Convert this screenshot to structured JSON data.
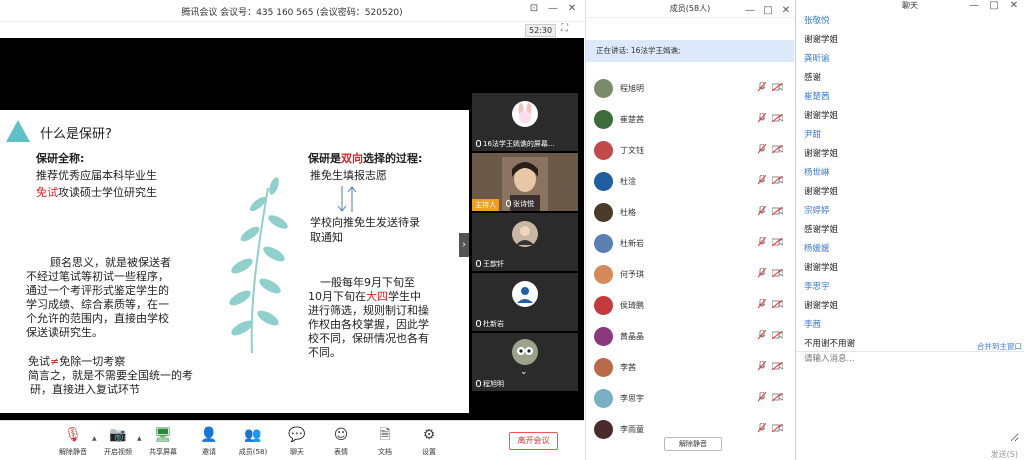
{
  "meeting": {
    "title": "腾讯会议 会议号：435 160 565  (会议密码：520520)",
    "timer": "52:30",
    "leave_label": "离开会议",
    "toolbar": [
      {
        "label": "解除静音",
        "icon": "mic-muted-icon"
      },
      {
        "label": "开启视频",
        "icon": "camera-off-icon"
      },
      {
        "label": "共享屏幕",
        "icon": "share-screen-icon"
      },
      {
        "label": "邀请",
        "icon": "invite-icon"
      },
      {
        "label": "成员(58)",
        "icon": "members-icon"
      },
      {
        "label": "聊天",
        "icon": "chat-icon"
      },
      {
        "label": "表情",
        "icon": "emoji-icon"
      },
      {
        "label": "文档",
        "icon": "document-icon"
      },
      {
        "label": "设置",
        "icon": "settings-icon"
      }
    ]
  },
  "slide": {
    "title": "什么是保研?",
    "left_heading": "保研全称:",
    "left_line1": "推荐优秀应届本科毕业生",
    "left_line2_red": "免试",
    "left_line2_rest": "攻读硕士学位研究生",
    "para": [
      "顾名思义，就是被保送者",
      "不经过笔试等初试一些程序，",
      "通过一个考评形式鉴定学生的",
      "学习成绩、综合素质等，在一",
      "个允许的范围内，直接由学校",
      "保送读研究生。"
    ],
    "exempt_pre": "免试",
    "exempt_sym": "≠",
    "exempt_post": "免除一切考察",
    "summary": [
      "简言之，就是不需要全国统一的考",
      "研，直接进入复试环节"
    ],
    "right_heading_pre": "保研是",
    "right_heading_red": "双向",
    "right_heading_post": "选择的过程:",
    "right_line1": "推免生填报志愿",
    "right_line2": [
      "学校向推免生发送待录",
      "取通知"
    ],
    "right_para": [
      {
        "pre": "一般每年9月下旬至",
        "red": "",
        "post": ""
      },
      {
        "pre": "10月下旬在",
        "red": "大四",
        "post": "学生中"
      },
      {
        "pre": "进行筛选，规则制订和操",
        "red": "",
        "post": ""
      },
      {
        "pre": "作权由各校掌握，因此学",
        "red": "",
        "post": ""
      },
      {
        "pre": "校不同，保研情况也各有",
        "red": "",
        "post": ""
      },
      {
        "pre": "不同。",
        "red": "",
        "post": ""
      }
    ]
  },
  "thumbs": [
    {
      "name": "16法学王嫣谯的屏幕..."
    },
    {
      "name": "张诗悦",
      "tag": "主持人"
    },
    {
      "name": "王歆钎"
    },
    {
      "name": "杜新岩"
    },
    {
      "name": "程旭明"
    }
  ],
  "members": {
    "title": "成员(58人)",
    "speaking": "正在讲话: 16法学王嫣谯;",
    "unmute_all": "解除静音",
    "list": [
      {
        "name": "程旭明",
        "color": "#7a8a6a"
      },
      {
        "name": "崔楚茜",
        "color": "#3d6b3a"
      },
      {
        "name": "丁文钰",
        "color": "#c24a4a"
      },
      {
        "name": "杜淦",
        "color": "#1f5f9f"
      },
      {
        "name": "杜格",
        "color": "#4a3a2a"
      },
      {
        "name": "杜新岩",
        "color": "#5a7fb0"
      },
      {
        "name": "何予琪",
        "color": "#d48a5a"
      },
      {
        "name": "侯琦鹏",
        "color": "#c43a3a"
      },
      {
        "name": "黄晶晶",
        "color": "#8a3a7a"
      },
      {
        "name": "李茜",
        "color": "#b86a4a"
      },
      {
        "name": "李思宇",
        "color": "#7ab0c4"
      },
      {
        "name": "李雨童",
        "color": "#4a2a2a"
      }
    ]
  },
  "chat": {
    "title": "聊天",
    "open_main": "合并到主窗口",
    "placeholder": "请输入消息...",
    "send": "发送(S)",
    "messages": [
      {
        "sender": "张敬悦",
        "text": "谢谢学姐"
      },
      {
        "sender": "龚昕谕",
        "text": "感谢"
      },
      {
        "sender": "崔楚茜",
        "text": "谢谢学姐"
      },
      {
        "sender": "尹甜",
        "text": "谢谢学姐"
      },
      {
        "sender": "杨世崊",
        "text": "谢谢学姐"
      },
      {
        "sender": "宗婷婷",
        "text": "感谢学姐"
      },
      {
        "sender": "杨媛媛",
        "text": "谢谢学姐"
      },
      {
        "sender": "李思宇",
        "text": "谢谢学姐"
      },
      {
        "sender": "李茜",
        "text": "不用谢不用谢"
      }
    ]
  }
}
